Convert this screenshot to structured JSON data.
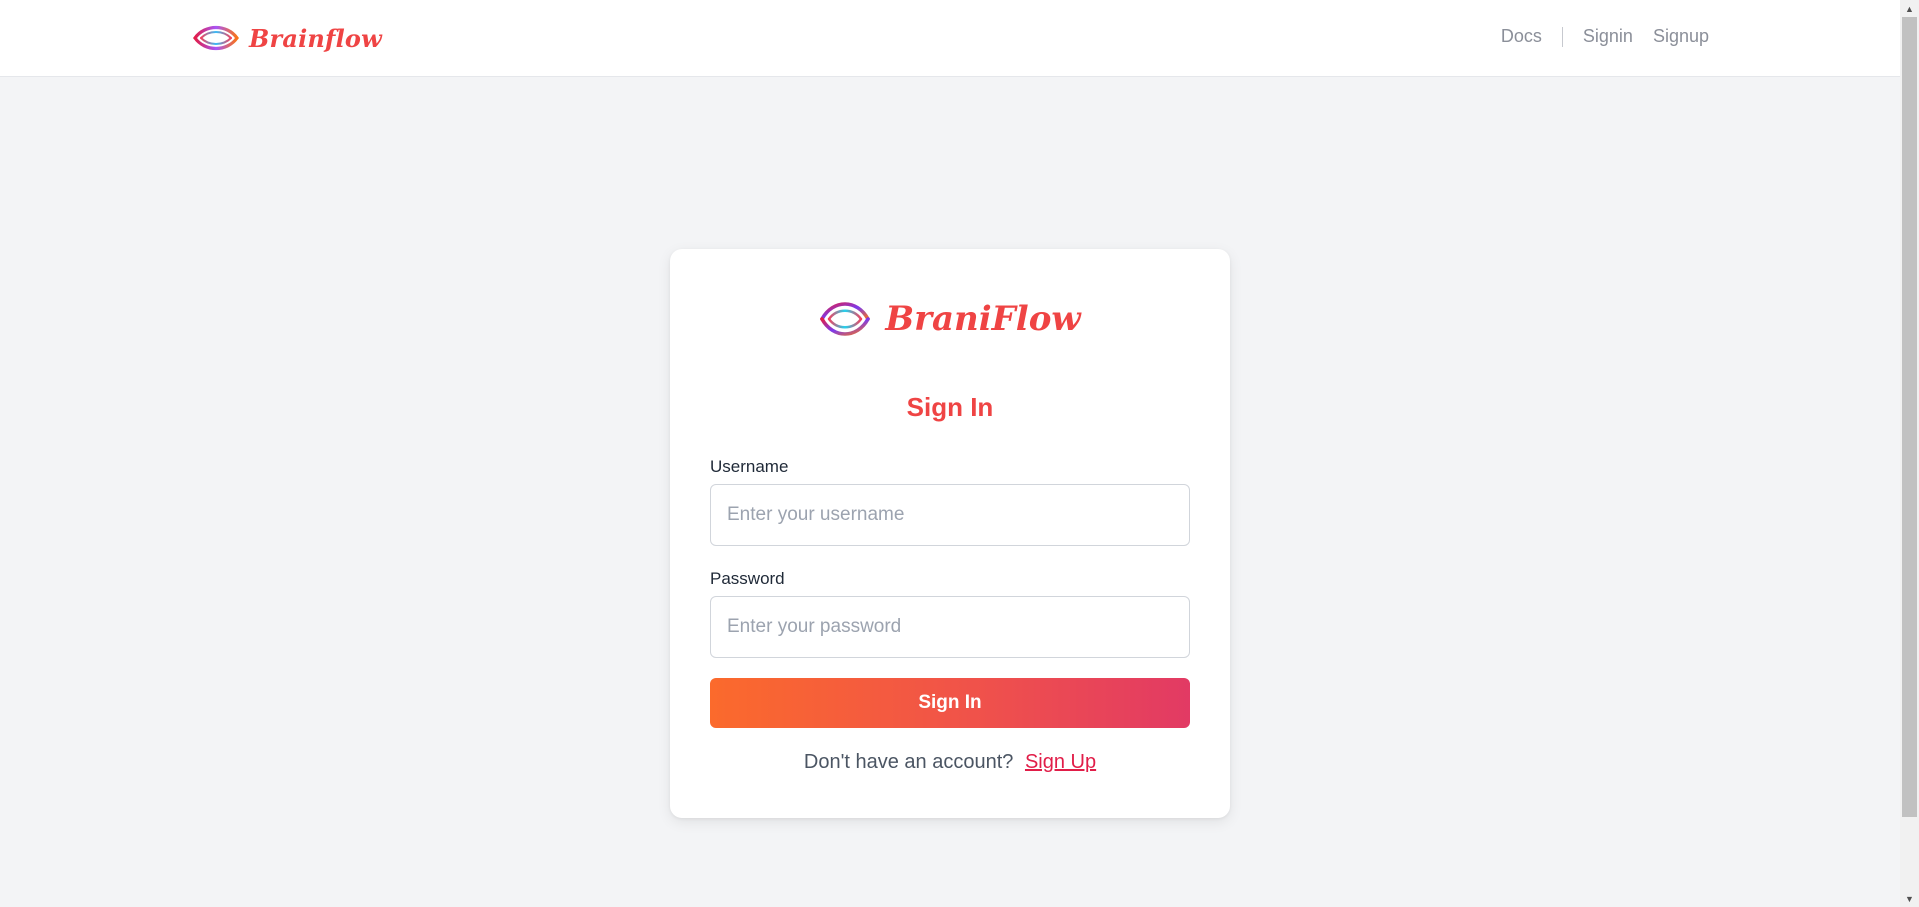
{
  "header": {
    "brand_name": "Brainflow",
    "nav": {
      "docs": "Docs",
      "signin": "Signin",
      "signup": "Signup"
    }
  },
  "card": {
    "brand_name": "BraniFlow",
    "title": "Sign In",
    "username": {
      "label": "Username",
      "placeholder": "Enter your username",
      "value": ""
    },
    "password": {
      "label": "Password",
      "placeholder": "Enter your password",
      "value": ""
    },
    "submit_label": "Sign In",
    "footer": {
      "prompt": "Don't have an account?",
      "link": "Sign Up"
    }
  },
  "colors": {
    "brand": "#ef4444",
    "background": "#f3f4f6",
    "button_gradient_start": "#fb6a2c",
    "button_gradient_end": "#e23a64"
  },
  "icons": {
    "logo": "brainflow-logo-icon"
  }
}
